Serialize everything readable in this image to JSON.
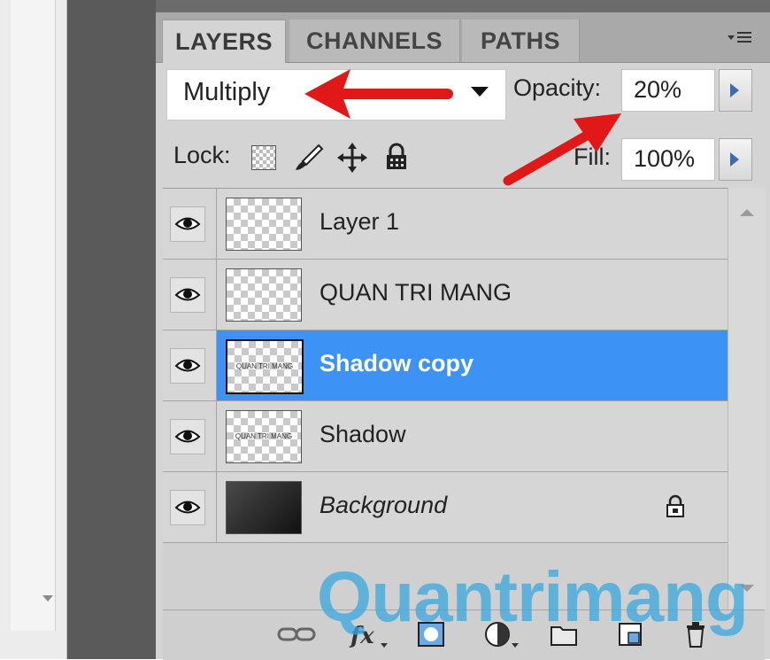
{
  "tabs": [
    {
      "label": "LAYERS",
      "active": true
    },
    {
      "label": "CHANNELS",
      "active": false
    },
    {
      "label": "PATHS",
      "active": false
    }
  ],
  "blend_mode": {
    "selected": "Multiply"
  },
  "opacity": {
    "label": "Opacity:",
    "value": "20%"
  },
  "lock": {
    "label": "Lock:"
  },
  "fill": {
    "label": "Fill:",
    "value": "100%"
  },
  "layers": [
    {
      "name": "Layer 1",
      "visible": true,
      "selected": false,
      "italic": false,
      "thumbnail": "transparent"
    },
    {
      "name": "QUAN TRI MANG",
      "visible": true,
      "selected": false,
      "italic": false,
      "thumbnail": "transparent"
    },
    {
      "name": "Shadow copy",
      "visible": true,
      "selected": true,
      "italic": false,
      "thumbnail": "text",
      "thumb_text": "QUAN TRI MANG"
    },
    {
      "name": "Shadow",
      "visible": true,
      "selected": false,
      "italic": false,
      "thumbnail": "text",
      "thumb_text": "QUAN TRI MANG"
    },
    {
      "name": "Background",
      "visible": true,
      "selected": false,
      "italic": true,
      "thumbnail": "dark",
      "locked": true
    }
  ],
  "bottom_icons": [
    "link-icon",
    "fx-icon",
    "mask-icon",
    "adjustment-icon",
    "group-icon",
    "new-layer-icon",
    "trash-icon"
  ],
  "watermark": "Quantrimang",
  "colors": {
    "selection": "#3d93f5",
    "arrow": "#e01818",
    "watermark": "#39a8de"
  }
}
